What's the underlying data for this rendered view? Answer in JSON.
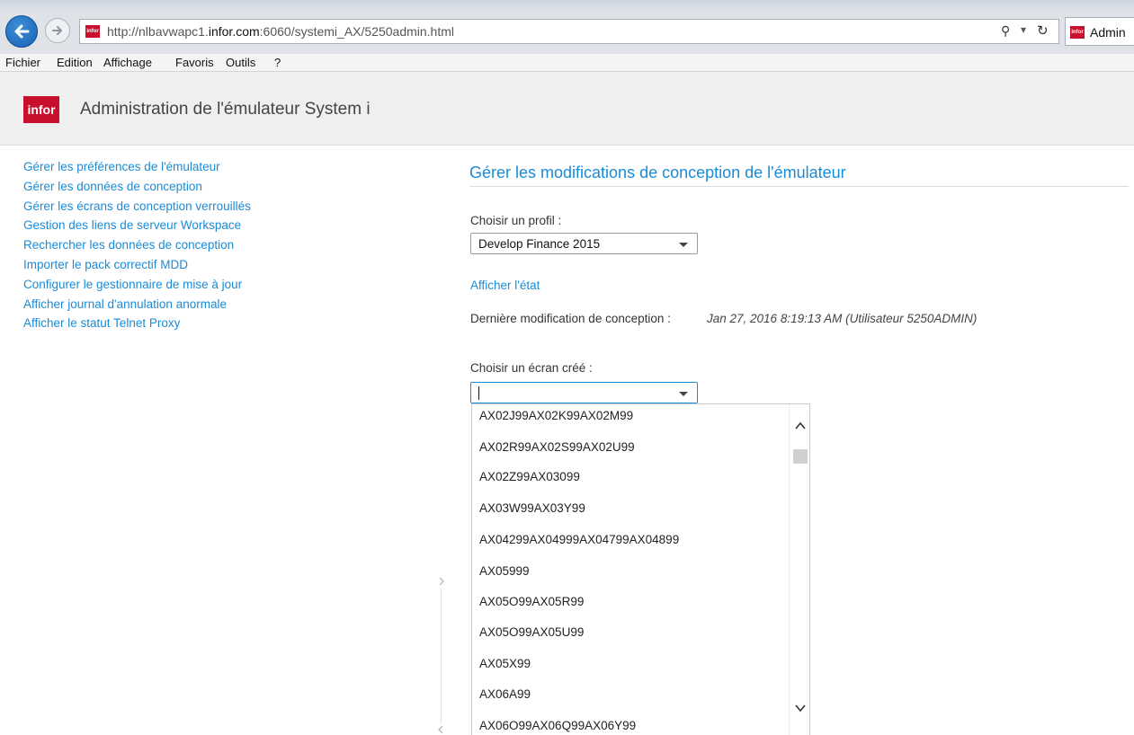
{
  "browser": {
    "url_prefix": "http://nlbavwapc1.",
    "url_domain": "infor.com",
    "url_suffix": ":6060/systemi_AX/5250admin.html",
    "favicon_text": "infor",
    "search_glyph": "⚲",
    "dropdown_glyph": "▾",
    "refresh_glyph": "↻",
    "tab_title": "Admin",
    "menu": [
      "Fichier",
      "Edition",
      "Affichage",
      "Favoris",
      "Outils",
      "?"
    ]
  },
  "header": {
    "logo_text": "infor",
    "title": "Administration de l'émulateur System i"
  },
  "nav": {
    "items": [
      "Gérer les préférences de l'émulateur",
      "Gérer les données de conception",
      "Gérer les écrans de conception verrouillés",
      "Gestion des liens de serveur Workspace",
      "Rechercher les données de conception",
      "Importer le pack correctif MDD",
      "Configurer le gestionnaire de mise à jour",
      "Afficher journal d'annulation anormale",
      "Afficher le statut Telnet Proxy"
    ]
  },
  "main": {
    "section_title": "Gérer les modifications de conception de l'émulateur",
    "profile_label": "Choisir un profil :",
    "profile_value": "Develop Finance 2015",
    "status_link": "Afficher l'état",
    "last_mod_label": "Dernière modification de conception :",
    "last_mod_value": "Jan 27, 2016 8:19:13 AM (Utilisateur 5250ADMIN)",
    "screen_label": "Choisir un écran créé :",
    "screen_value": "",
    "screen_options": [
      "AX02J99AX02K99AX02M99",
      "AX02R99AX02S99AX02U99",
      "AX02Z99AX03099",
      "AX03W99AX03Y99",
      "AX04299AX04999AX04799AX04899",
      "AX05999",
      "AX05O99AX05R99",
      "AX05O99AX05U99",
      "AX05X99",
      "AX06A99",
      "AX06O99AX06Q99AX06Y99"
    ]
  },
  "colors": {
    "accent": "#1a8bd6",
    "brand": "#c8102e"
  }
}
